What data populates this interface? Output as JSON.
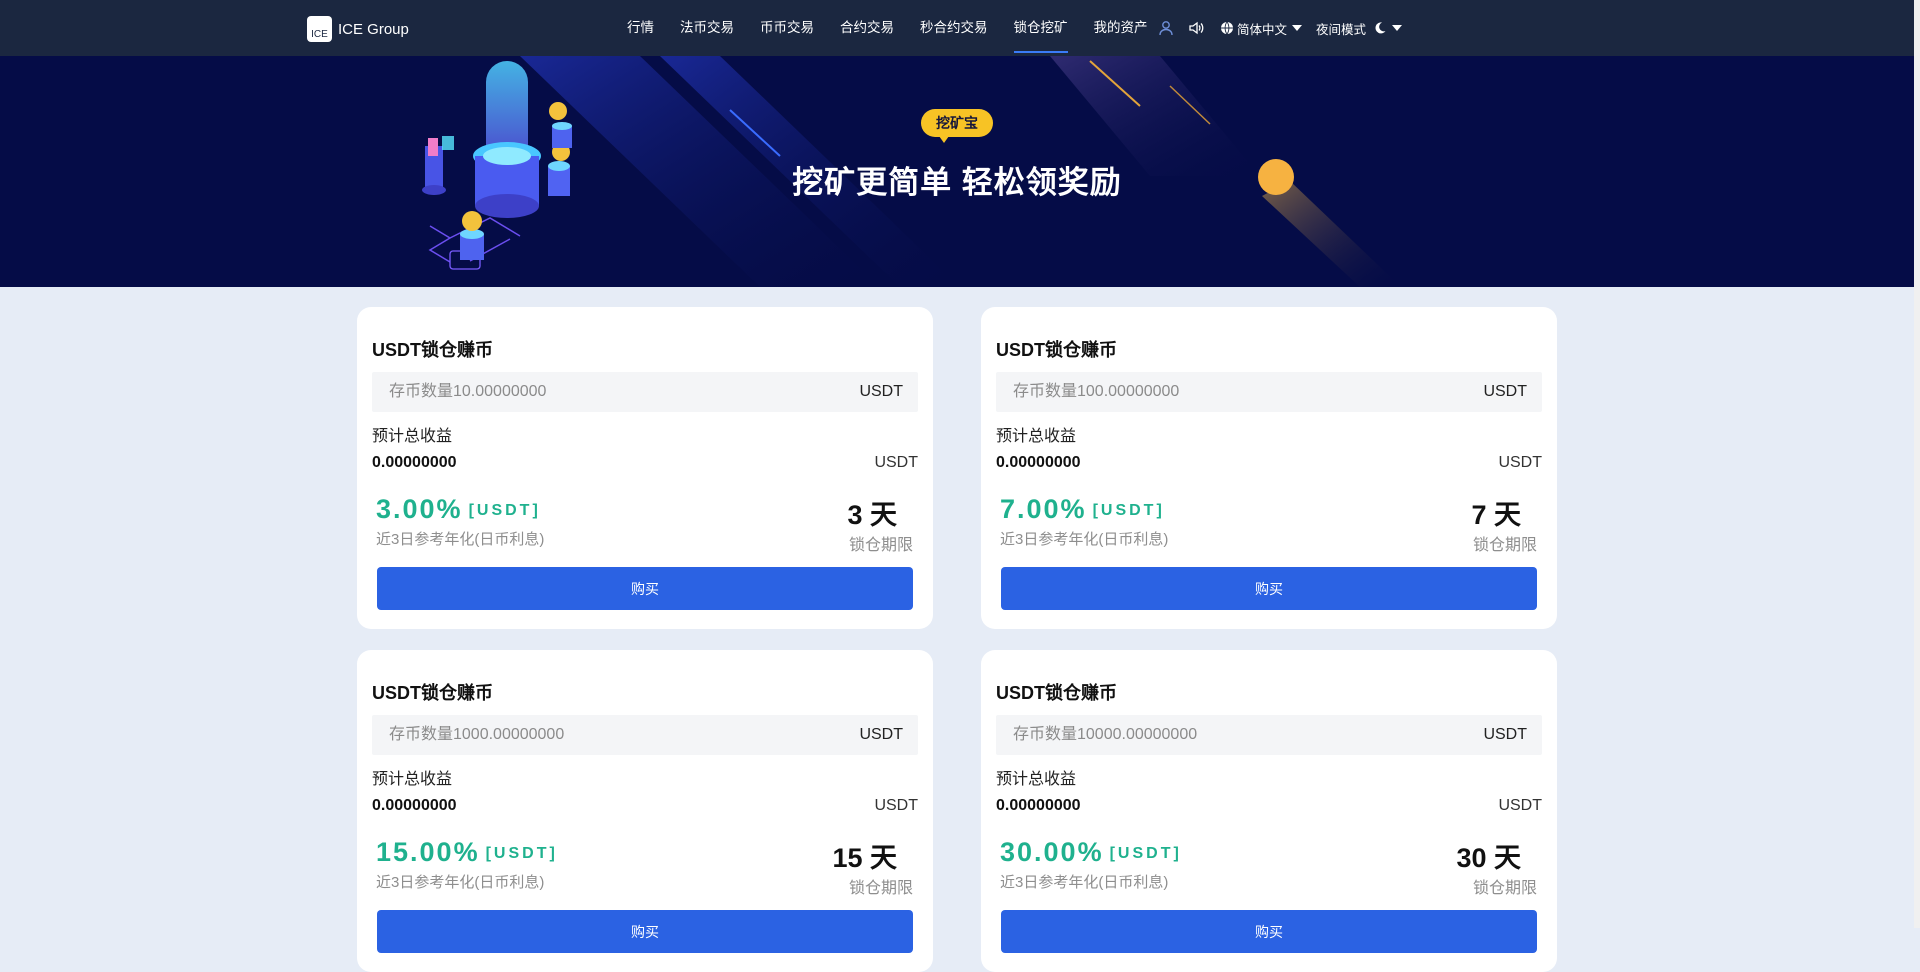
{
  "app": {
    "logo_mark": "ICE",
    "name": "ICE Group"
  },
  "nav": {
    "items": [
      {
        "label": "行情"
      },
      {
        "label": "法币交易"
      },
      {
        "label": "币币交易"
      },
      {
        "label": "合约交易"
      },
      {
        "label": "秒合约交易"
      },
      {
        "label": "锁仓挖矿",
        "active": true
      },
      {
        "label": "我的资产"
      }
    ],
    "language": "简体中文",
    "night_mode": "夜间模式"
  },
  "banner": {
    "badge": "挖矿宝",
    "title": "挖矿更简单 轻松领奖励"
  },
  "cards": [
    {
      "title": "USDT锁仓赚币",
      "placeholder": "存币数量10.00000000",
      "unit": "USDT",
      "est_label": "预计总收益",
      "est_value": "0.00000000",
      "est_unit": "USDT",
      "rate": "3.00%",
      "rate_unit": "[USDT]",
      "rate_note": "近3日参考年化(日币利息)",
      "days": "3 天",
      "days_label": "锁仓期限",
      "buy_label": "购买"
    },
    {
      "title": "USDT锁仓赚币",
      "placeholder": "存币数量100.00000000",
      "unit": "USDT",
      "est_label": "预计总收益",
      "est_value": "0.00000000",
      "est_unit": "USDT",
      "rate": "7.00%",
      "rate_unit": "[USDT]",
      "rate_note": "近3日参考年化(日币利息)",
      "days": "7 天",
      "days_label": "锁仓期限",
      "buy_label": "购买"
    },
    {
      "title": "USDT锁仓赚币",
      "placeholder": "存币数量1000.00000000",
      "unit": "USDT",
      "est_label": "预计总收益",
      "est_value": "0.00000000",
      "est_unit": "USDT",
      "rate": "15.00%",
      "rate_unit": "[USDT]",
      "rate_note": "近3日参考年化(日币利息)",
      "days": "15 天",
      "days_label": "锁仓期限",
      "buy_label": "购买"
    },
    {
      "title": "USDT锁仓赚币",
      "placeholder": "存币数量10000.00000000",
      "unit": "USDT",
      "est_label": "预计总收益",
      "est_value": "0.00000000",
      "est_unit": "USDT",
      "rate": "30.00%",
      "rate_unit": "[USDT]",
      "rate_note": "近3日参考年化(日币利息)",
      "days": "30 天",
      "days_label": "锁仓期限",
      "buy_label": "购买"
    }
  ],
  "colors": {
    "nav_bg": "#1b2740",
    "banner_bg": "#050c47",
    "accent": "#2b62e3",
    "rate": "#1fb18e",
    "badge": "#f7c325",
    "page_bg": "#e6ecf6"
  },
  "icons": [
    "user-icon",
    "speaker-icon",
    "globe-icon",
    "moon-icon"
  ]
}
